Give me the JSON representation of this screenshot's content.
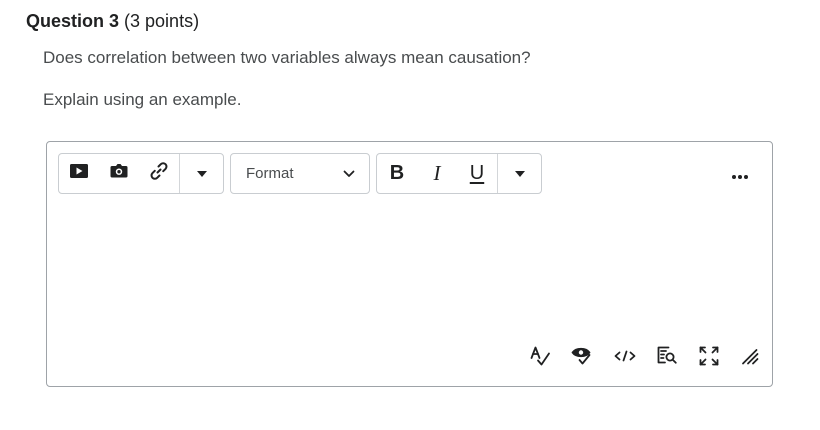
{
  "question": {
    "title": "Question 3",
    "points": "(3 points)",
    "text_line1": "Does correlation between two variables always mean causation?",
    "text_line2": "Explain using an example."
  },
  "toolbar": {
    "format_label": "Format",
    "bold_label": "B",
    "italic_label": "I",
    "underline_label": "U"
  },
  "icons": {
    "insert_video": "video-icon",
    "insert_image": "camera-icon",
    "insert_link": "link-icon",
    "insert_more": "caret-down-icon",
    "format_chevron": "chevron-down-icon",
    "text_more": "caret-down-icon",
    "more_actions": "ellipsis-icon",
    "spellcheck": "spellcheck-icon",
    "accessibility": "accessibility-checker-icon",
    "source_code": "source-code-icon",
    "preview": "preview-icon",
    "fullscreen": "fullscreen-icon",
    "resize": "resize-handle-icon"
  },
  "colors": {
    "text": "#494c4e",
    "heading": "#202122",
    "border": "#9ea3a8"
  }
}
